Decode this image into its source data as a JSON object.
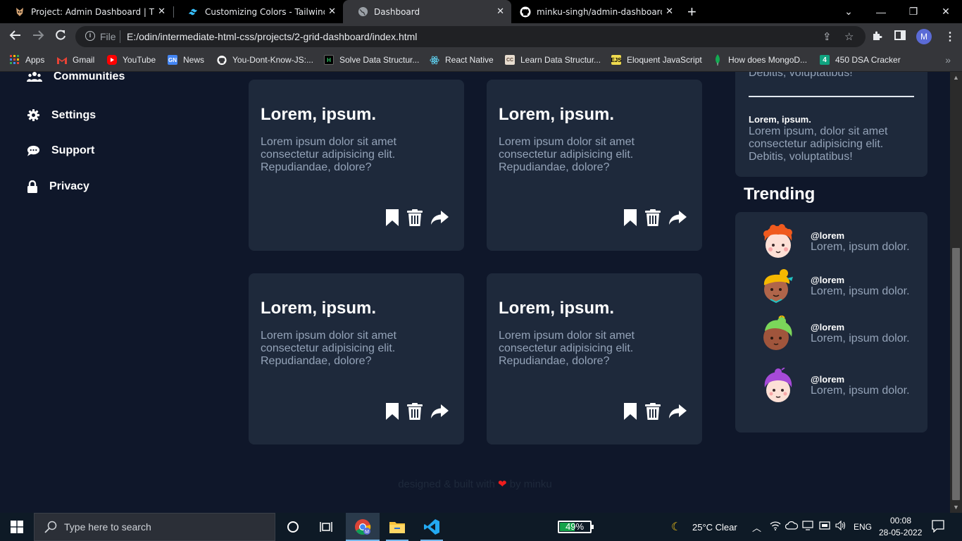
{
  "browser": {
    "tabs": [
      {
        "title": "Project: Admin Dashboard | The Odin Project",
        "icon": "odin-favicon-icon"
      },
      {
        "title": "Customizing Colors - Tailwind CSS",
        "icon": "tailwind-favicon-icon"
      },
      {
        "title": "Dashboard",
        "icon": "globe-icon",
        "active": true
      },
      {
        "title": "minku-singh/admin-dashboard: Project",
        "icon": "github-favicon-icon"
      }
    ],
    "address": {
      "scheme_label": "File",
      "url": "E:/odin/intermediate-html-css/projects/2-grid-dashboard/index.html"
    },
    "profile_initial": "M",
    "bookmarks": [
      {
        "label": "Apps",
        "icon": "apps-grid-icon",
        "color": "#ea4335"
      },
      {
        "label": "Gmail",
        "icon": "gmail-icon",
        "color": "#ea4335"
      },
      {
        "label": "YouTube",
        "icon": "youtube-icon",
        "color": "#ff0000"
      },
      {
        "label": "News",
        "icon": "google-news-icon",
        "color": "#4285f4"
      },
      {
        "label": "You-Dont-Know-JS:...",
        "icon": "github-icon",
        "color": "#ffffff"
      },
      {
        "label": "Solve Data Structur...",
        "icon": "hackerrank-icon",
        "color": "#1f1f1f"
      },
      {
        "label": "React Native",
        "icon": "react-icon",
        "color": "#61dafb"
      },
      {
        "label": "Learn Data Structur...",
        "icon": "codechef-icon",
        "color": "#5b4638"
      },
      {
        "label": "Eloquent JavaScript",
        "icon": "eloquent-js-icon",
        "color": "#f0db4f"
      },
      {
        "label": "How does MongoD...",
        "icon": "mongodb-leaf-icon",
        "color": "#13aa52"
      },
      {
        "label": "450 DSA Cracker",
        "icon": "dsa-cracker-icon",
        "color": "#10a37f"
      }
    ]
  },
  "sidebar": {
    "items": [
      {
        "label": "Communities",
        "icon": "communities-icon"
      },
      {
        "label": "Settings",
        "icon": "gear-icon"
      },
      {
        "label": "Support",
        "icon": "chat-icon"
      },
      {
        "label": "Privacy",
        "icon": "lock-icon"
      }
    ]
  },
  "cards": [
    {
      "title": "Lorem, ipsum.",
      "body": "Lorem ipsum dolor sit amet consectetur adipisicing elit. Repudiandae, dolore?"
    },
    {
      "title": "Lorem, ipsum.",
      "body": "Lorem ipsum dolor sit amet consectetur adipisicing elit. Repudiandae, dolore?"
    },
    {
      "title": "Lorem, ipsum.",
      "body": "Lorem ipsum dolor sit amet consectetur adipisicing elit. Repudiandae, dolore?"
    },
    {
      "title": "Lorem, ipsum.",
      "body": "Lorem ipsum dolor sit amet consectetur adipisicing elit. Repudiandae, dolore?"
    }
  ],
  "announcements": {
    "partial_text": "Debitis, voluptatibus!",
    "items": [
      {
        "title": "Lorem, ipsum.",
        "text": "Lorem ipsum, dolor sit amet consectetur adipisicing elit. Debitis, voluptatibus!"
      }
    ]
  },
  "trending": {
    "heading": "Trending",
    "items": [
      {
        "handle": "@lorem",
        "text": "Lorem, ipsum dolor.",
        "hair_color": "#f05a1e",
        "skin_color": "#fde0d6"
      },
      {
        "handle": "@lorem",
        "text": "Lorem, ipsum dolor.",
        "hair_color": "#f5b800",
        "skin_color": "#b0654a"
      },
      {
        "handle": "@lorem",
        "text": "Lorem, ipsum dolor.",
        "hair_color": "#7bd65a",
        "skin_color": "#a0553c"
      },
      {
        "handle": "@lorem",
        "text": "Lorem, ipsum dolor.",
        "hair_color": "#a64ad8",
        "skin_color": "#fde0d6"
      }
    ]
  },
  "footer": {
    "before": "designed & built with",
    "after": "by minku"
  },
  "taskbar": {
    "search_placeholder": "Type here to search",
    "battery_percent": "49%",
    "battery_level": 0.49,
    "weather": "25°C  Clear",
    "language": "ENG",
    "time": "00:08",
    "date": "28-05-2022"
  },
  "colors": {
    "background": "#0f172a",
    "card": "#1e293b",
    "muted_text": "#94a3b8",
    "heart": "#ef1d1d"
  }
}
